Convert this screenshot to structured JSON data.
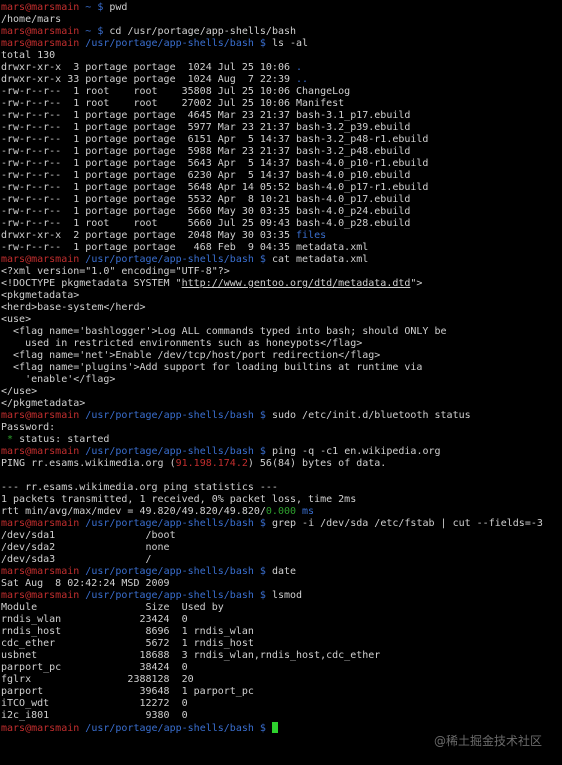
{
  "terminal": {
    "lines": [
      [
        {
          "t": "mars@marsmain",
          "c": "user"
        },
        {
          "t": " ~ ",
          "c": "path"
        },
        {
          "t": "$ ",
          "c": "pr"
        },
        {
          "t": "pwd",
          "c": "out"
        }
      ],
      [
        {
          "t": "/home/mars",
          "c": "out"
        }
      ],
      [
        {
          "t": "mars@marsmain",
          "c": "user"
        },
        {
          "t": " ~ ",
          "c": "path"
        },
        {
          "t": "$ ",
          "c": "pr"
        },
        {
          "t": "cd /usr/portage/app-shells/bash",
          "c": "out"
        }
      ],
      [
        {
          "t": "mars@marsmain",
          "c": "user"
        },
        {
          "t": " /usr/portage/app-shells/bash ",
          "c": "path"
        },
        {
          "t": "$ ",
          "c": "pr"
        },
        {
          "t": "ls -al",
          "c": "out"
        }
      ],
      [
        {
          "t": "total 130",
          "c": "out"
        }
      ],
      [
        {
          "t": "drwxr-xr-x  3 portage portage  1024 Jul 25 10:06 ",
          "c": "out"
        },
        {
          "t": ".",
          "c": "dir"
        }
      ],
      [
        {
          "t": "drwxr-xr-x 33 portage portage  1024 Aug  7 22:39 ",
          "c": "out"
        },
        {
          "t": "..",
          "c": "dir"
        }
      ],
      [
        {
          "t": "-rw-r--r--  1 root    root    35808 Jul 25 10:06 ChangeLog",
          "c": "out"
        }
      ],
      [
        {
          "t": "-rw-r--r--  1 root    root    27002 Jul 25 10:06 Manifest",
          "c": "out"
        }
      ],
      [
        {
          "t": "-rw-r--r--  1 portage portage  4645 Mar 23 21:37 bash-3.1_p17.ebuild",
          "c": "out"
        }
      ],
      [
        {
          "t": "-rw-r--r--  1 portage portage  5977 Mar 23 21:37 bash-3.2_p39.ebuild",
          "c": "out"
        }
      ],
      [
        {
          "t": "-rw-r--r--  1 portage portage  6151 Apr  5 14:37 bash-3.2_p48-r1.ebuild",
          "c": "out"
        }
      ],
      [
        {
          "t": "-rw-r--r--  1 portage portage  5988 Mar 23 21:37 bash-3.2_p48.ebuild",
          "c": "out"
        }
      ],
      [
        {
          "t": "-rw-r--r--  1 portage portage  5643 Apr  5 14:37 bash-4.0_p10-r1.ebuild",
          "c": "out"
        }
      ],
      [
        {
          "t": "-rw-r--r--  1 portage portage  6230 Apr  5 14:37 bash-4.0_p10.ebuild",
          "c": "out"
        }
      ],
      [
        {
          "t": "-rw-r--r--  1 portage portage  5648 Apr 14 05:52 bash-4.0_p17-r1.ebuild",
          "c": "out"
        }
      ],
      [
        {
          "t": "-rw-r--r--  1 portage portage  5532 Apr  8 10:21 bash-4.0_p17.ebuild",
          "c": "out"
        }
      ],
      [
        {
          "t": "-rw-r--r--  1 portage portage  5660 May 30 03:35 bash-4.0_p24.ebuild",
          "c": "out"
        }
      ],
      [
        {
          "t": "-rw-r--r--  1 root    root     5660 Jul 25 09:43 bash-4.0_p28.ebuild",
          "c": "out"
        }
      ],
      [
        {
          "t": "drwxr-xr-x  2 portage portage  2048 May 30 03:35 ",
          "c": "out"
        },
        {
          "t": "files",
          "c": "dir"
        }
      ],
      [
        {
          "t": "-rw-r--r--  1 portage portage   468 Feb  9 04:35 metadata.xml",
          "c": "out"
        }
      ],
      [
        {
          "t": "mars@marsmain",
          "c": "user"
        },
        {
          "t": " /usr/portage/app-shells/bash ",
          "c": "path"
        },
        {
          "t": "$ ",
          "c": "pr"
        },
        {
          "t": "cat metadata.xml",
          "c": "out"
        }
      ],
      [
        {
          "t": "<?xml version=\"1.0\" encoding=\"UTF-8\"?>",
          "c": "out"
        }
      ],
      [
        {
          "t": "<!DOCTYPE pkgmetadata SYSTEM \"",
          "c": "out"
        },
        {
          "t": "http://www.gentoo.org/dtd/metadata.dtd",
          "c": "link"
        },
        {
          "t": "\">",
          "c": "out"
        }
      ],
      [
        {
          "t": "<pkgmetadata>",
          "c": "out"
        }
      ],
      [
        {
          "t": "<herd>base-system</herd>",
          "c": "out"
        }
      ],
      [
        {
          "t": "<use>",
          "c": "out"
        }
      ],
      [
        {
          "t": "  <flag name='bashlogger'>Log ALL commands typed into bash; should ONLY be",
          "c": "out"
        }
      ],
      [
        {
          "t": "    used in restricted environments such as honeypots</flag>",
          "c": "out"
        }
      ],
      [
        {
          "t": "  <flag name='net'>Enable /dev/tcp/host/port redirection</flag>",
          "c": "out"
        }
      ],
      [
        {
          "t": "  <flag name='plugins'>Add support for loading builtins at runtime via",
          "c": "out"
        }
      ],
      [
        {
          "t": "    'enable'</flag>",
          "c": "out"
        }
      ],
      [
        {
          "t": "</use>",
          "c": "out"
        }
      ],
      [
        {
          "t": "</pkgmetadata>",
          "c": "out"
        }
      ],
      [
        {
          "t": "mars@marsmain",
          "c": "user"
        },
        {
          "t": " /usr/portage/app-shells/bash ",
          "c": "path"
        },
        {
          "t": "$ ",
          "c": "pr"
        },
        {
          "t": "sudo /etc/init.d/bluetooth status",
          "c": "out"
        }
      ],
      [
        {
          "t": "Password:",
          "c": "out"
        }
      ],
      [
        {
          "t": " * ",
          "c": "ok"
        },
        {
          "t": "status: started",
          "c": "out"
        }
      ],
      [
        {
          "t": "mars@marsmain",
          "c": "user"
        },
        {
          "t": " /usr/portage/app-shells/bash ",
          "c": "path"
        },
        {
          "t": "$ ",
          "c": "pr"
        },
        {
          "t": "ping -q -c1 en.wikipedia.org",
          "c": "out"
        }
      ],
      [
        {
          "t": "PING rr.esams.wikimedia.org (",
          "c": "out"
        },
        {
          "t": "91.198.174.2",
          "c": "ip"
        },
        {
          "t": ") 56(84) bytes of data.",
          "c": "out"
        }
      ],
      [
        {
          "t": "",
          "c": "out"
        }
      ],
      [
        {
          "t": "--- rr.esams.wikimedia.org ping statistics ---",
          "c": "out"
        }
      ],
      [
        {
          "t": "1 packets transmitted, 1 received, 0% packet loss, time 2ms",
          "c": "out"
        }
      ],
      [
        {
          "t": "rtt min/avg/max/mdev = 49.820/49.820/49.820/",
          "c": "out"
        },
        {
          "t": "0.000",
          "c": "ok"
        },
        {
          "t": " ms",
          "c": "ms"
        }
      ],
      [
        {
          "t": "mars@marsmain",
          "c": "user"
        },
        {
          "t": " /usr/portage/app-shells/bash ",
          "c": "path"
        },
        {
          "t": "$ ",
          "c": "pr"
        },
        {
          "t": "grep -i /dev/sda /etc/fstab | cut --fields=-3",
          "c": "out"
        }
      ],
      [
        {
          "t": "/dev/sda1               /boot",
          "c": "out"
        }
      ],
      [
        {
          "t": "/dev/sda2               none",
          "c": "out"
        }
      ],
      [
        {
          "t": "/dev/sda3               /",
          "c": "out"
        }
      ],
      [
        {
          "t": "mars@marsmain",
          "c": "user"
        },
        {
          "t": " /usr/portage/app-shells/bash ",
          "c": "path"
        },
        {
          "t": "$ ",
          "c": "pr"
        },
        {
          "t": "date",
          "c": "out"
        }
      ],
      [
        {
          "t": "Sat Aug  8 02:42:24 MSD 2009",
          "c": "out"
        }
      ],
      [
        {
          "t": "mars@marsmain",
          "c": "user"
        },
        {
          "t": " /usr/portage/app-shells/bash ",
          "c": "path"
        },
        {
          "t": "$ ",
          "c": "pr"
        },
        {
          "t": "lsmod",
          "c": "out"
        }
      ],
      [
        {
          "t": "Module                  Size  Used by",
          "c": "out"
        }
      ],
      [
        {
          "t": "rndis_wlan             23424  0",
          "c": "out"
        }
      ],
      [
        {
          "t": "rndis_host              8696  1 rndis_wlan",
          "c": "out"
        }
      ],
      [
        {
          "t": "cdc_ether               5672  1 rndis_host",
          "c": "out"
        }
      ],
      [
        {
          "t": "usbnet                 18688  3 rndis_wlan,rndis_host,cdc_ether",
          "c": "out"
        }
      ],
      [
        {
          "t": "parport_pc             38424  0",
          "c": "out"
        }
      ],
      [
        {
          "t": "fglrx                2388128  20",
          "c": "out"
        }
      ],
      [
        {
          "t": "parport                39648  1 parport_pc",
          "c": "out"
        }
      ],
      [
        {
          "t": "iTCO_wdt               12272  0",
          "c": "out"
        }
      ],
      [
        {
          "t": "i2c_i801                9380  0",
          "c": "out"
        }
      ],
      [
        {
          "t": "mars@marsmain",
          "c": "user"
        },
        {
          "t": " /usr/portage/app-shells/bash ",
          "c": "path"
        },
        {
          "t": "$ ",
          "c": "pr"
        }
      ]
    ]
  },
  "colors": {
    "background": "#000000",
    "text": "#d0d0d0",
    "user": "#c22e2e",
    "path": "#3a6fd0",
    "cursor": "#2ed22e"
  },
  "watermark": "@稀土掘金技术社区"
}
